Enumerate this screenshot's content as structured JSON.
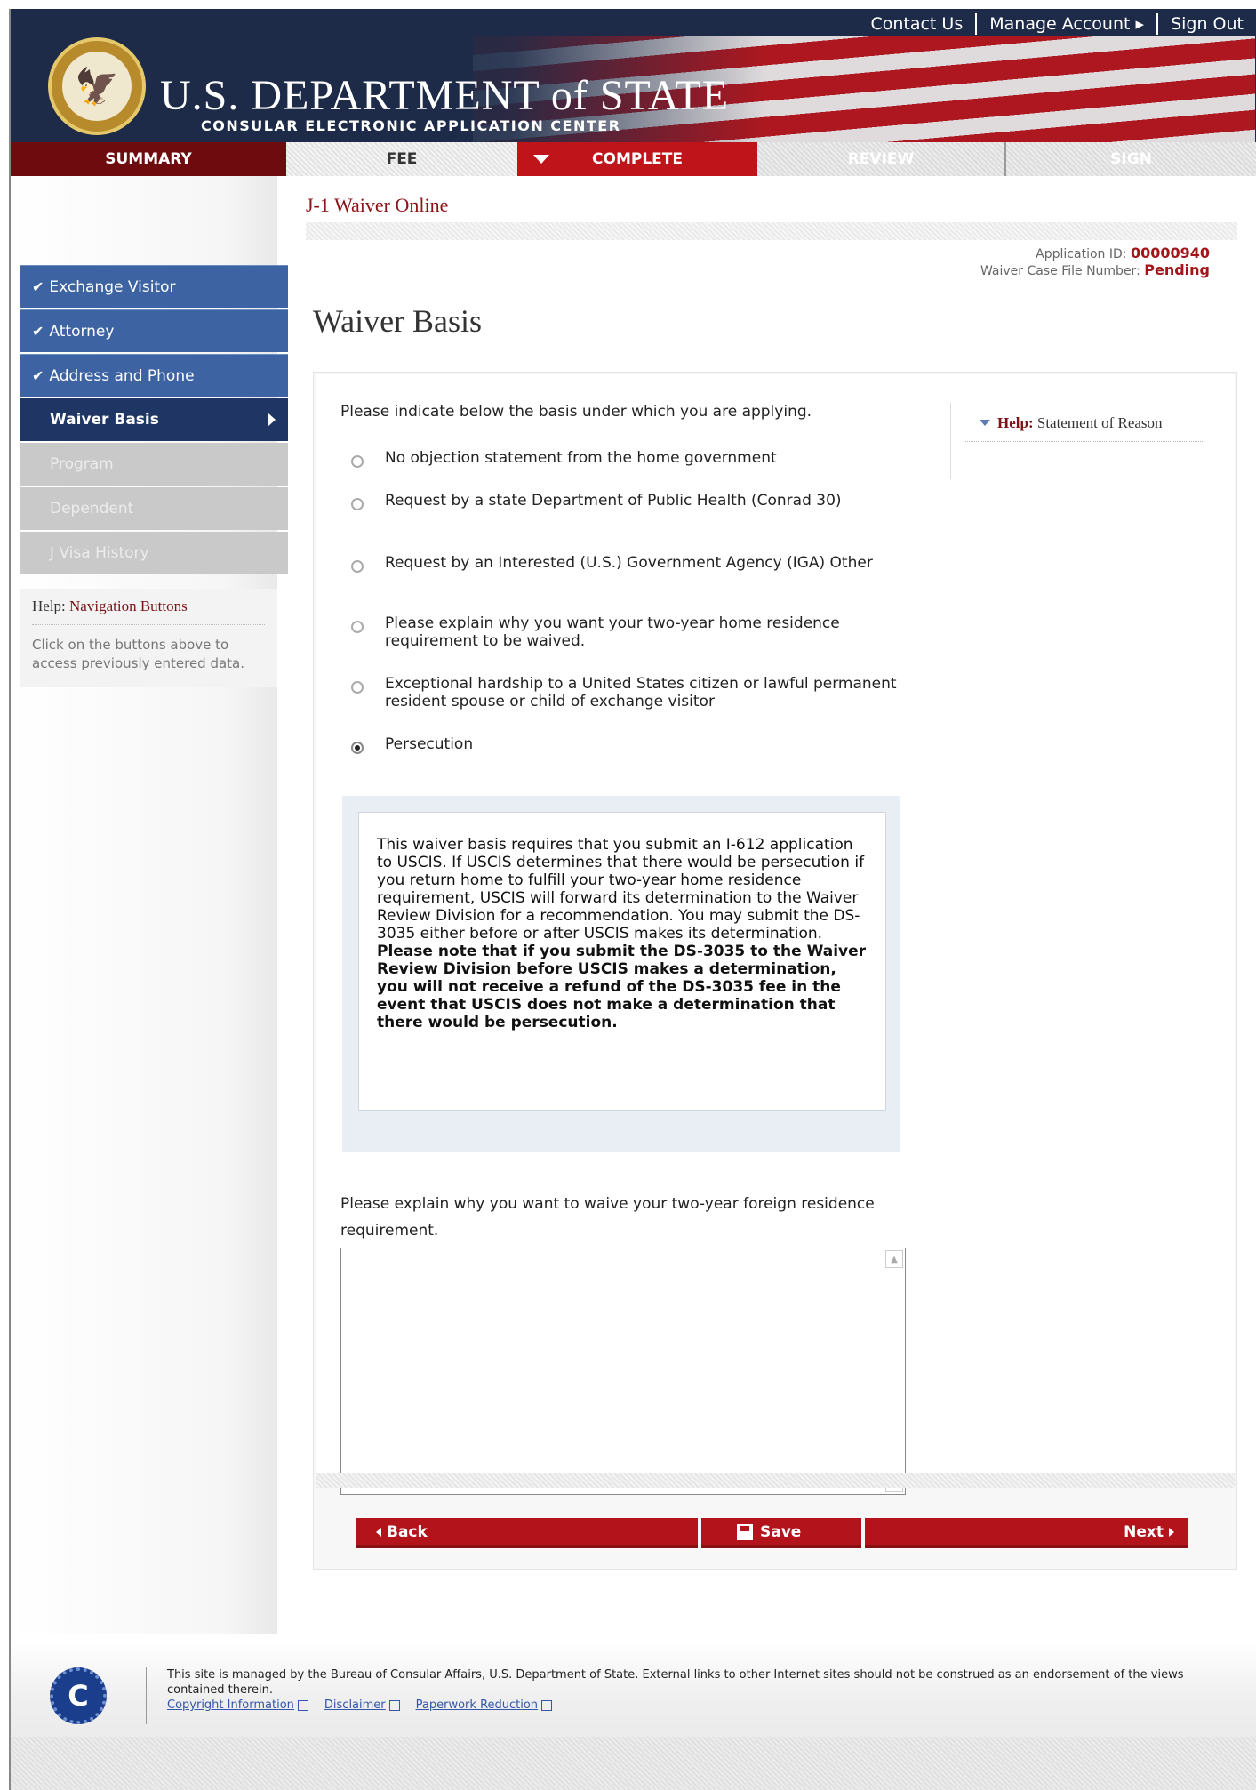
{
  "header": {
    "top_links": [
      "Contact Us",
      "Manage Account",
      "Sign Out"
    ],
    "dept_title": "U.S. DEPARTMENT of STATE",
    "dept_subtitle": "CONSULAR ELECTRONIC APPLICATION CENTER"
  },
  "steps": [
    "SUMMARY",
    "FEE",
    "COMPLETE",
    "REVIEW",
    "SIGN"
  ],
  "sidebar": {
    "items": [
      {
        "label": "Exchange Visitor",
        "state": "done"
      },
      {
        "label": "Attorney",
        "state": "done"
      },
      {
        "label": "Address and Phone",
        "state": "done"
      },
      {
        "label": "Waiver Basis",
        "state": "active"
      },
      {
        "label": "Program",
        "state": "disabled"
      },
      {
        "label": "Dependent",
        "state": "disabled"
      },
      {
        "label": "J Visa History",
        "state": "disabled"
      }
    ],
    "help_title_prefix": "Help:",
    "help_title": "Navigation Buttons",
    "help_text": "Click on the buttons above to access previously entered data."
  },
  "app": {
    "name": "J-1 Waiver Online",
    "id_label": "Application ID:",
    "id_value": "00000940",
    "case_label": "Waiver Case File Number:",
    "case_value": "Pending"
  },
  "main": {
    "title": "Waiver Basis",
    "question": "Please indicate below the basis under which you are applying.",
    "options": [
      {
        "label": "No objection statement from the home government",
        "selected": false
      },
      {
        "label": "Request by a state Department of Public Health (Conrad 30)",
        "selected": false
      },
      {
        "label": "Request by an Interested (U.S.) Government Agency (IGA) Other",
        "selected": false
      },
      {
        "label": "Please explain why you want your two-year home residence requirement to be waived.",
        "selected": false
      },
      {
        "label": "Exceptional hardship to a United States citizen or lawful permanent resident spouse or child of exchange visitor",
        "selected": false
      },
      {
        "label": "Persecution",
        "selected": true
      }
    ],
    "note_text": "This waiver basis requires that you submit an I-612 application to USCIS. If USCIS determines that there would be persecution if you return home to fulfill your two-year home residence requirement, USCIS will forward its determination to the Waiver Review Division for a recommendation. You may submit the DS-3035 either before or after USCIS makes its determination.",
    "note_bold": "Please note that if you submit the DS-3035 to the Waiver Review Division before USCIS makes a determination, you will not receive a refund of the DS-3035 fee in the event that USCIS does not make a determination that there would be persecution.",
    "explain_label": "Please explain why you want to waive your two-year foreign residence requirement.",
    "explain_value": "",
    "help_prefix": "Help:",
    "help_title": "Statement of Reason"
  },
  "buttons": {
    "back": "Back",
    "save": "Save",
    "next": "Next"
  },
  "footer": {
    "text": "This site is managed by the Bureau of Consular Affairs, U.S. Department of State. External links to other Internet sites should not be construed as an endorsement of the views contained therein.",
    "links": [
      "Copyright Information",
      "Disclaimer",
      "Paperwork Reduction"
    ]
  },
  "colors": {
    "accent_red": "#b3141b",
    "nav_blue": "#3d63a3",
    "nav_active": "#1f3563"
  }
}
